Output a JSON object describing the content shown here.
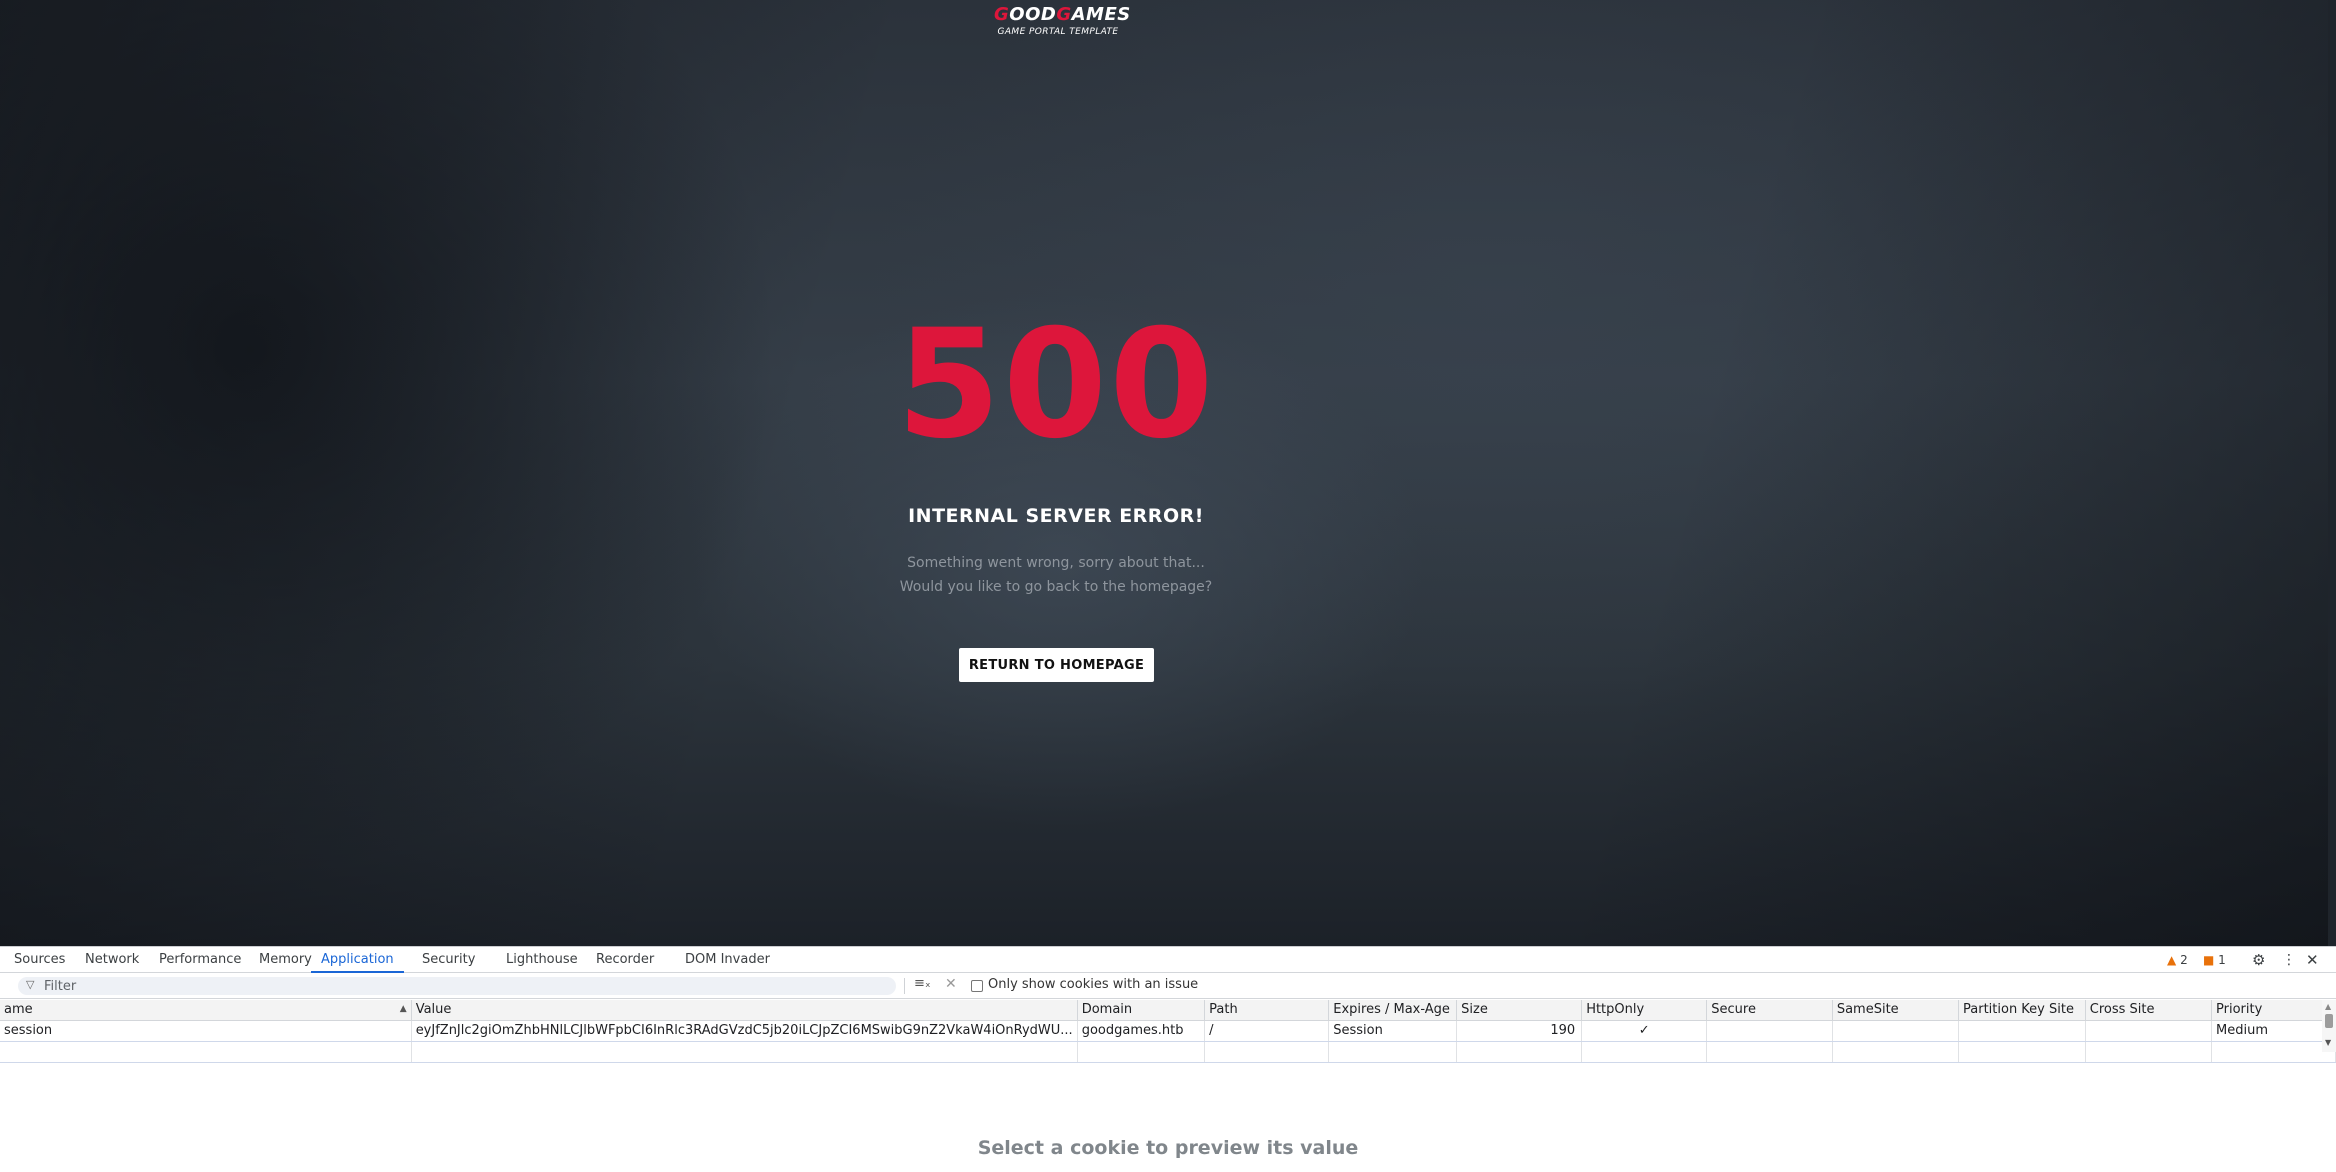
{
  "page": {
    "logo_main_accent_1": "G",
    "logo_main_part_1": "OOD",
    "logo_main_accent_2": "G",
    "logo_main_part_2": "AMES",
    "logo_sub": "GAME PORTAL TEMPLATE",
    "error_code": "500",
    "error_title": "INTERNAL SERVER ERROR!",
    "error_line_1": "Something went wrong, sorry about that...",
    "error_line_2": "Would you like to go back to the homepage?",
    "button_label": "RETURN TO HOMEPAGE",
    "accent_color": "#dd163b"
  },
  "devtools": {
    "tabs": [
      "Sources",
      "Network",
      "Performance",
      "Memory",
      "Application",
      "Security",
      "Lighthouse",
      "Recorder",
      "DOM Invader"
    ],
    "active_tab": "Application",
    "warnings_count": "2",
    "messages_count": "1",
    "filter_placeholder": "Filter",
    "only_issues_label": "Only show cookies with an issue",
    "columns": [
      "ame",
      "Value",
      "Domain",
      "Path",
      "Expires / Max-Age",
      "Size",
      "HttpOnly",
      "Secure",
      "SameSite",
      "Partition Key Site",
      "Cross Site",
      "Priority"
    ],
    "cookie": {
      "name": "session",
      "value": "eyJfZnJlc2giOmZhbHNlLCJlbWFpbCI6InRlc3RAdGVzdC5jb20iLCJpZCI6MSwibG9nZ2VkaW4iOnRydWU...",
      "domain": "goodgames.htb",
      "path": "/",
      "expires": "Session",
      "size": "190",
      "httponly": "✓",
      "secure": "",
      "samesite": "",
      "partition_key_site": "",
      "cross_site": "",
      "priority": "Medium"
    },
    "preview_text": "Select a cookie to preview its value",
    "active_color": "#1a66d6"
  }
}
